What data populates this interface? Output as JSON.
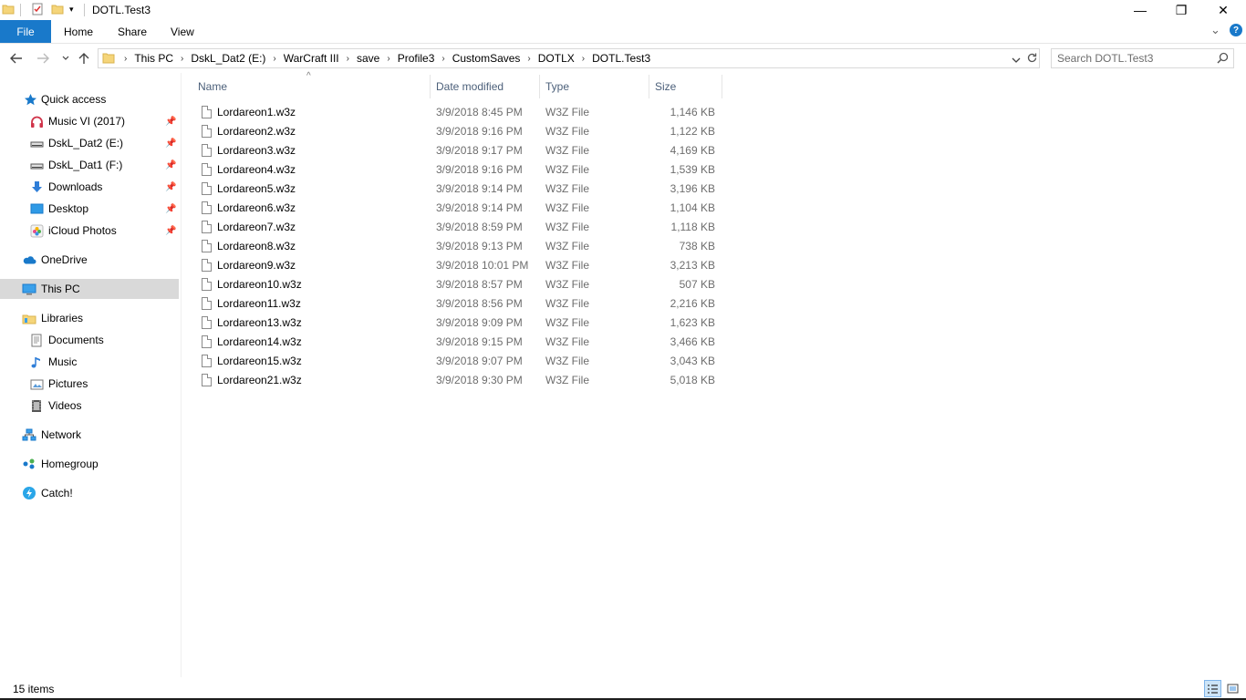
{
  "window": {
    "title": "DOTL.Test3",
    "minimize_glyph": "—",
    "restore_glyph": "❐",
    "close_glyph": "✕"
  },
  "ribbon": {
    "file": "File",
    "tabs": [
      "Home",
      "Share",
      "View"
    ],
    "expand_glyph": "⌄",
    "help_glyph": "?"
  },
  "address": {
    "crumbs": [
      "This PC",
      "DskL_Dat2 (E:)",
      "WarCraft III",
      "save",
      "Profile3",
      "CustomSaves",
      "DOTLX",
      "DOTL.Test3"
    ],
    "separator": "›"
  },
  "search": {
    "placeholder": "Search DOTL.Test3"
  },
  "sidebar": {
    "items": [
      {
        "label": "Quick access",
        "icon": "star-icon"
      },
      {
        "label": "Music VI (2017)",
        "icon": "headphones-icon",
        "pinned": true
      },
      {
        "label": "DskL_Dat2 (E:)",
        "icon": "drive-icon",
        "pinned": true
      },
      {
        "label": "DskL_Dat1 (F:)",
        "icon": "drive-icon",
        "pinned": true
      },
      {
        "label": "Downloads",
        "icon": "download-arrow-icon",
        "pinned": true
      },
      {
        "label": "Desktop",
        "icon": "desktop-icon",
        "pinned": true
      },
      {
        "label": "iCloud Photos",
        "icon": "icloud-photos-icon",
        "pinned": true
      },
      {
        "label": "OneDrive",
        "icon": "cloud-icon"
      },
      {
        "label": "This PC",
        "icon": "computer-icon",
        "selected": true
      },
      {
        "label": "Libraries",
        "icon": "libraries-icon"
      },
      {
        "label": "Documents",
        "icon": "documents-icon"
      },
      {
        "label": "Music",
        "icon": "music-note-icon"
      },
      {
        "label": "Pictures",
        "icon": "pictures-icon"
      },
      {
        "label": "Videos",
        "icon": "videos-icon"
      },
      {
        "label": "Network",
        "icon": "network-icon"
      },
      {
        "label": "Homegroup",
        "icon": "homegroup-icon"
      },
      {
        "label": "Catch!",
        "icon": "catch-icon"
      }
    ]
  },
  "columns": {
    "name": "Name",
    "date": "Date modified",
    "type": "Type",
    "size": "Size",
    "sort_glyph": "^"
  },
  "files": [
    {
      "name": "Lordareon1.w3z",
      "date": "3/9/2018 8:45 PM",
      "type": "W3Z File",
      "size": "1,146 KB"
    },
    {
      "name": "Lordareon2.w3z",
      "date": "3/9/2018 9:16 PM",
      "type": "W3Z File",
      "size": "1,122 KB"
    },
    {
      "name": "Lordareon3.w3z",
      "date": "3/9/2018 9:17 PM",
      "type": "W3Z File",
      "size": "4,169 KB"
    },
    {
      "name": "Lordareon4.w3z",
      "date": "3/9/2018 9:16 PM",
      "type": "W3Z File",
      "size": "1,539 KB"
    },
    {
      "name": "Lordareon5.w3z",
      "date": "3/9/2018 9:14 PM",
      "type": "W3Z File",
      "size": "3,196 KB"
    },
    {
      "name": "Lordareon6.w3z",
      "date": "3/9/2018 9:14 PM",
      "type": "W3Z File",
      "size": "1,104 KB"
    },
    {
      "name": "Lordareon7.w3z",
      "date": "3/9/2018 8:59 PM",
      "type": "W3Z File",
      "size": "1,118 KB"
    },
    {
      "name": "Lordareon8.w3z",
      "date": "3/9/2018 9:13 PM",
      "type": "W3Z File",
      "size": "738 KB"
    },
    {
      "name": "Lordareon9.w3z",
      "date": "3/9/2018 10:01 PM",
      "type": "W3Z File",
      "size": "3,213 KB"
    },
    {
      "name": "Lordareon10.w3z",
      "date": "3/9/2018 8:57 PM",
      "type": "W3Z File",
      "size": "507 KB"
    },
    {
      "name": "Lordareon11.w3z",
      "date": "3/9/2018 8:56 PM",
      "type": "W3Z File",
      "size": "2,216 KB"
    },
    {
      "name": "Lordareon13.w3z",
      "date": "3/9/2018 9:09 PM",
      "type": "W3Z File",
      "size": "1,623 KB"
    },
    {
      "name": "Lordareon14.w3z",
      "date": "3/9/2018 9:15 PM",
      "type": "W3Z File",
      "size": "3,466 KB"
    },
    {
      "name": "Lordareon15.w3z",
      "date": "3/9/2018 9:07 PM",
      "type": "W3Z File",
      "size": "3,043 KB"
    },
    {
      "name": "Lordareon21.w3z",
      "date": "3/9/2018 9:30 PM",
      "type": "W3Z File",
      "size": "5,018 KB"
    }
  ],
  "status": {
    "count": "15 items"
  },
  "colors": {
    "accent": "#1979ca",
    "selected_bg": "#d9d9d9",
    "header_text": "#4c607a",
    "secondary_text": "#6d6d6d"
  }
}
